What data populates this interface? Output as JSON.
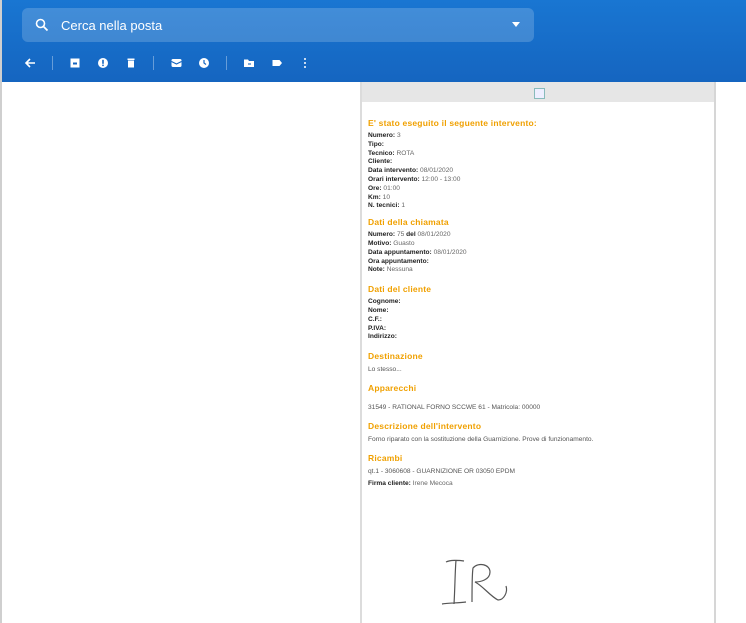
{
  "search": {
    "placeholder": "Cerca nella posta"
  },
  "toolbar": {
    "icons": [
      "back-arrow-icon",
      "archive-icon",
      "report-spam-icon",
      "delete-icon",
      "mark-unread-icon",
      "snooze-icon",
      "move-to-icon",
      "label-icon",
      "more-vert-icon"
    ]
  },
  "email": {
    "sec1_title": "E' stato eseguito il seguente intervento:",
    "numero_label": "Numero:",
    "numero_val": "3",
    "tipo_label": "Tipo:",
    "tipo_val": "",
    "tecnico_label": "Tecnico:",
    "tecnico_val": "ROTA",
    "cliente_label": "Cliente:",
    "cliente_val": "",
    "data_int_label": "Data intervento:",
    "data_int_val": "08/01/2020",
    "orari_label": "Orari intervento:",
    "orari_val": "12:00 - 13:00",
    "ore_label": "Ore:",
    "ore_val": "01:00",
    "km_label": "Km:",
    "km_val": "10",
    "ntec_label": "N. tecnici:",
    "ntec_val": "1",
    "sec2_title": "Dati della chiamata",
    "c_numero_label": "Numero:",
    "c_numero_val": "75",
    "c_del_label": "del",
    "c_del_val": "08/01/2020",
    "motivo_label": "Motivo:",
    "motivo_val": "Guasto",
    "data_app_label": "Data appuntamento:",
    "data_app_val": "08/01/2020",
    "ora_app_label": "Ora appuntamento:",
    "ora_app_val": "",
    "note_label": "Note:",
    "note_val": "Nessuna",
    "sec3_title": "Dati del cliente",
    "cognome_label": "Cognome:",
    "nome_label": "Nome:",
    "cf_label": "C.F.:",
    "piva_label": "P.IVA:",
    "indirizzo_label": "Indirizzo:",
    "sec4_title": "Destinazione",
    "destinazione_val": "Lo stesso...",
    "sec5_title": "Apparecchi",
    "apparecchi_val": "31549 - RATIONAL FORNO SCCWE 61 - Matricola: 00000",
    "sec6_title": "Descrizione dell'intervento",
    "descrizione_val": "Forno riparato con la sostituzione della Guarnizione. Prove di funzionamento.",
    "sec7_title": "Ricambi",
    "ricambi_val": "qt.1 - 3060608 - GUARNIZIONE OR 03050 EPDM",
    "firma_label": "Firma cliente:",
    "firma_val": "Irene Mecoca"
  }
}
